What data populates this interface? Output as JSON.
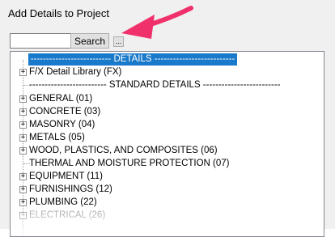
{
  "window": {
    "title": "Add Details to Project"
  },
  "search": {
    "value": "",
    "button_label": "Search",
    "browse_label": "..."
  },
  "tree": {
    "items": [
      {
        "label": "-------------------------- DETAILS --------------------------",
        "selected": true,
        "expander": false
      },
      {
        "label": "F/X Detail Library (FX)",
        "expander": true
      },
      {
        "label": "------------------------- STANDARD DETAILS -------------------------",
        "expander": false
      },
      {
        "label": "GENERAL (01)",
        "expander": true
      },
      {
        "label": "CONCRETE (03)",
        "expander": true
      },
      {
        "label": "MASONRY (04)",
        "expander": true
      },
      {
        "label": "METALS (05)",
        "expander": true
      },
      {
        "label": "WOOD, PLASTICS, AND COMPOSITES (06)",
        "expander": true
      },
      {
        "label": "THERMAL AND MOISTURE PROTECTION (07)",
        "expander": false
      },
      {
        "label": "EQUIPMENT (11)",
        "expander": true
      },
      {
        "label": "FURNISHINGS (12)",
        "expander": true
      },
      {
        "label": "PLUMBING (22)",
        "expander": true
      },
      {
        "label": "ELECTRICAL (26)",
        "expander": true
      }
    ]
  },
  "colors": {
    "selection": "#1979ca",
    "arrow": "#f0306a"
  },
  "icons": {
    "expander": "plus-box-icon",
    "annotation": "callout-arrow-icon"
  }
}
